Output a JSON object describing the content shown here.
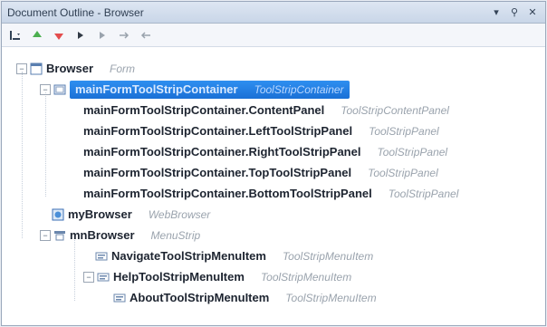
{
  "window": {
    "title": "Document Outline - Browser",
    "controls": {
      "pin": "▾",
      "dock": "⚲",
      "close": "✕"
    }
  },
  "toolbar": {
    "items": [
      {
        "name": "outline-menu-button",
        "glyph": "☰"
      },
      {
        "name": "move-up-button",
        "glyph": "▲"
      },
      {
        "name": "move-down-button",
        "glyph": "▼"
      },
      {
        "name": "collapse-button",
        "glyph": "▶"
      },
      {
        "name": "expand-button",
        "glyph": "▸"
      },
      {
        "name": "move-in-button",
        "glyph": "➜"
      },
      {
        "name": "move-out-button",
        "glyph": "➜"
      }
    ]
  },
  "tree": {
    "nodes": [
      {
        "name": "Browser",
        "type": "Form",
        "level": 0,
        "expander": "−",
        "icon": "form"
      },
      {
        "name": "mainFormToolStripContainer",
        "type": "ToolStripContainer",
        "level": 1,
        "expander": "−",
        "icon": "container",
        "selected": true
      },
      {
        "name": "mainFormToolStripContainer.ContentPanel",
        "type": "ToolStripContentPanel",
        "level": 2,
        "icon": "none"
      },
      {
        "name": "mainFormToolStripContainer.LeftToolStripPanel",
        "type": "ToolStripPanel",
        "level": 2,
        "icon": "none"
      },
      {
        "name": "mainFormToolStripContainer.RightToolStripPanel",
        "type": "ToolStripPanel",
        "level": 2,
        "icon": "none"
      },
      {
        "name": "mainFormToolStripContainer.TopToolStripPanel",
        "type": "ToolStripPanel",
        "level": 2,
        "icon": "none"
      },
      {
        "name": "mainFormToolStripContainer.BottomToolStripPanel",
        "type": "ToolStripPanel",
        "level": 2,
        "icon": "none"
      },
      {
        "name": "myBrowser",
        "type": "WebBrowser",
        "level": 1,
        "icon": "browser"
      },
      {
        "name": "mnBrowser",
        "type": "MenuStrip",
        "level": 1,
        "expander": "−",
        "icon": "menu"
      },
      {
        "name": "NavigateToolStripMenuItem",
        "type": "ToolStripMenuItem",
        "level": 2,
        "icon": "menuitem"
      },
      {
        "name": "HelpToolStripMenuItem",
        "type": "ToolStripMenuItem",
        "level": 2,
        "expander": "−",
        "icon": "menuitem"
      },
      {
        "name": "AboutToolStripMenuItem",
        "type": "ToolStripMenuItem",
        "level": 3,
        "icon": "menuitem"
      }
    ]
  },
  "colors": {
    "selection": "#1a70d6",
    "title_bg": "#c9d6e8",
    "type_text": "#9aa3ad",
    "name_text": "#1d2430"
  }
}
